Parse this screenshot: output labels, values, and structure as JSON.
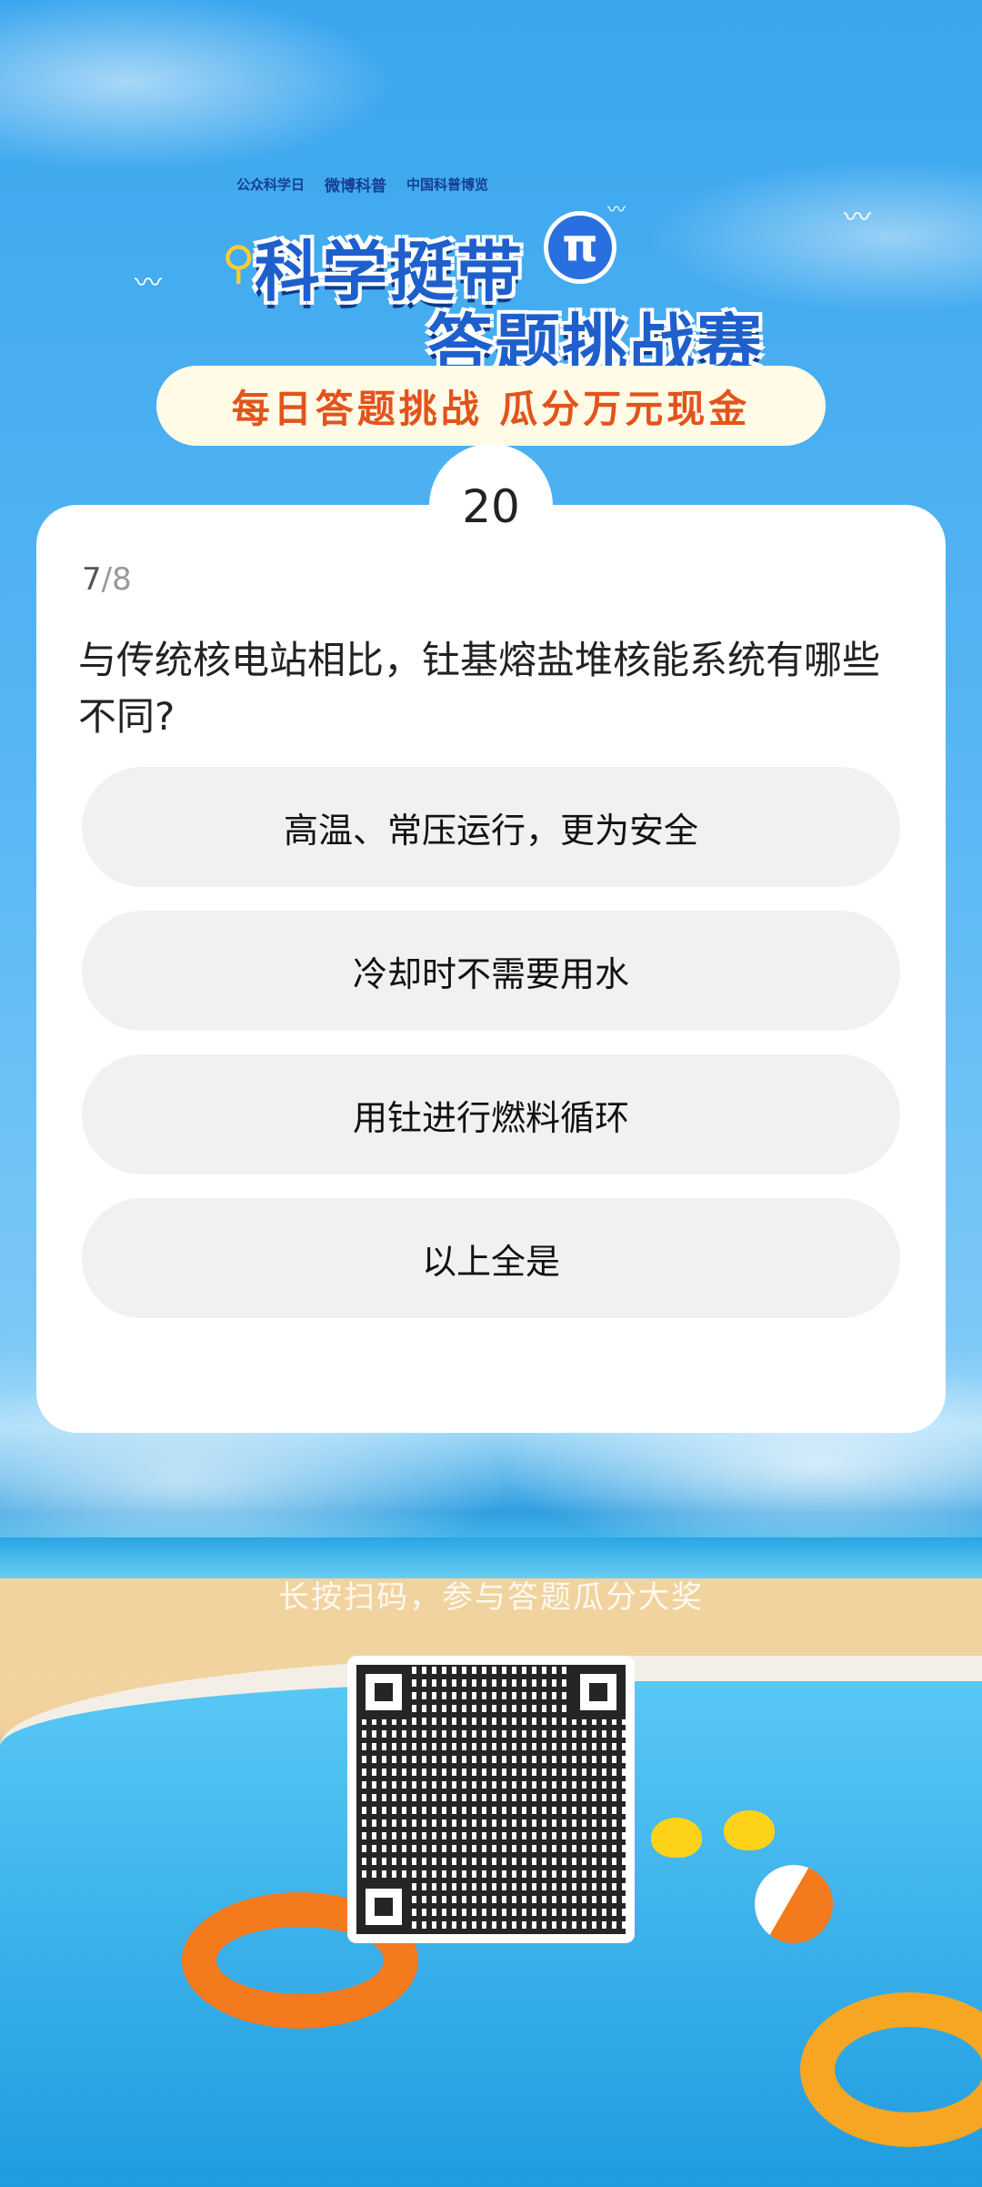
{
  "header": {
    "sponsors": [
      "公众科学日",
      "微博科普",
      "中国科普博览"
    ],
    "title_line1": "科学挺带",
    "title_pi": "π",
    "title_line2": "答题挑战赛",
    "banner": "每日答题挑战 瓜分万元现金"
  },
  "timer": "20",
  "quiz": {
    "current": "7",
    "total": "/8",
    "question": "与传统核电站相比，钍基熔盐堆核能系统有哪些不同?",
    "options": [
      "高温、常压运行，更为安全",
      "冷却时不需要用水",
      "用钍进行燃料循环",
      "以上全是"
    ]
  },
  "footer": {
    "scan_text": "长按扫码，参与答题瓜分大奖"
  }
}
